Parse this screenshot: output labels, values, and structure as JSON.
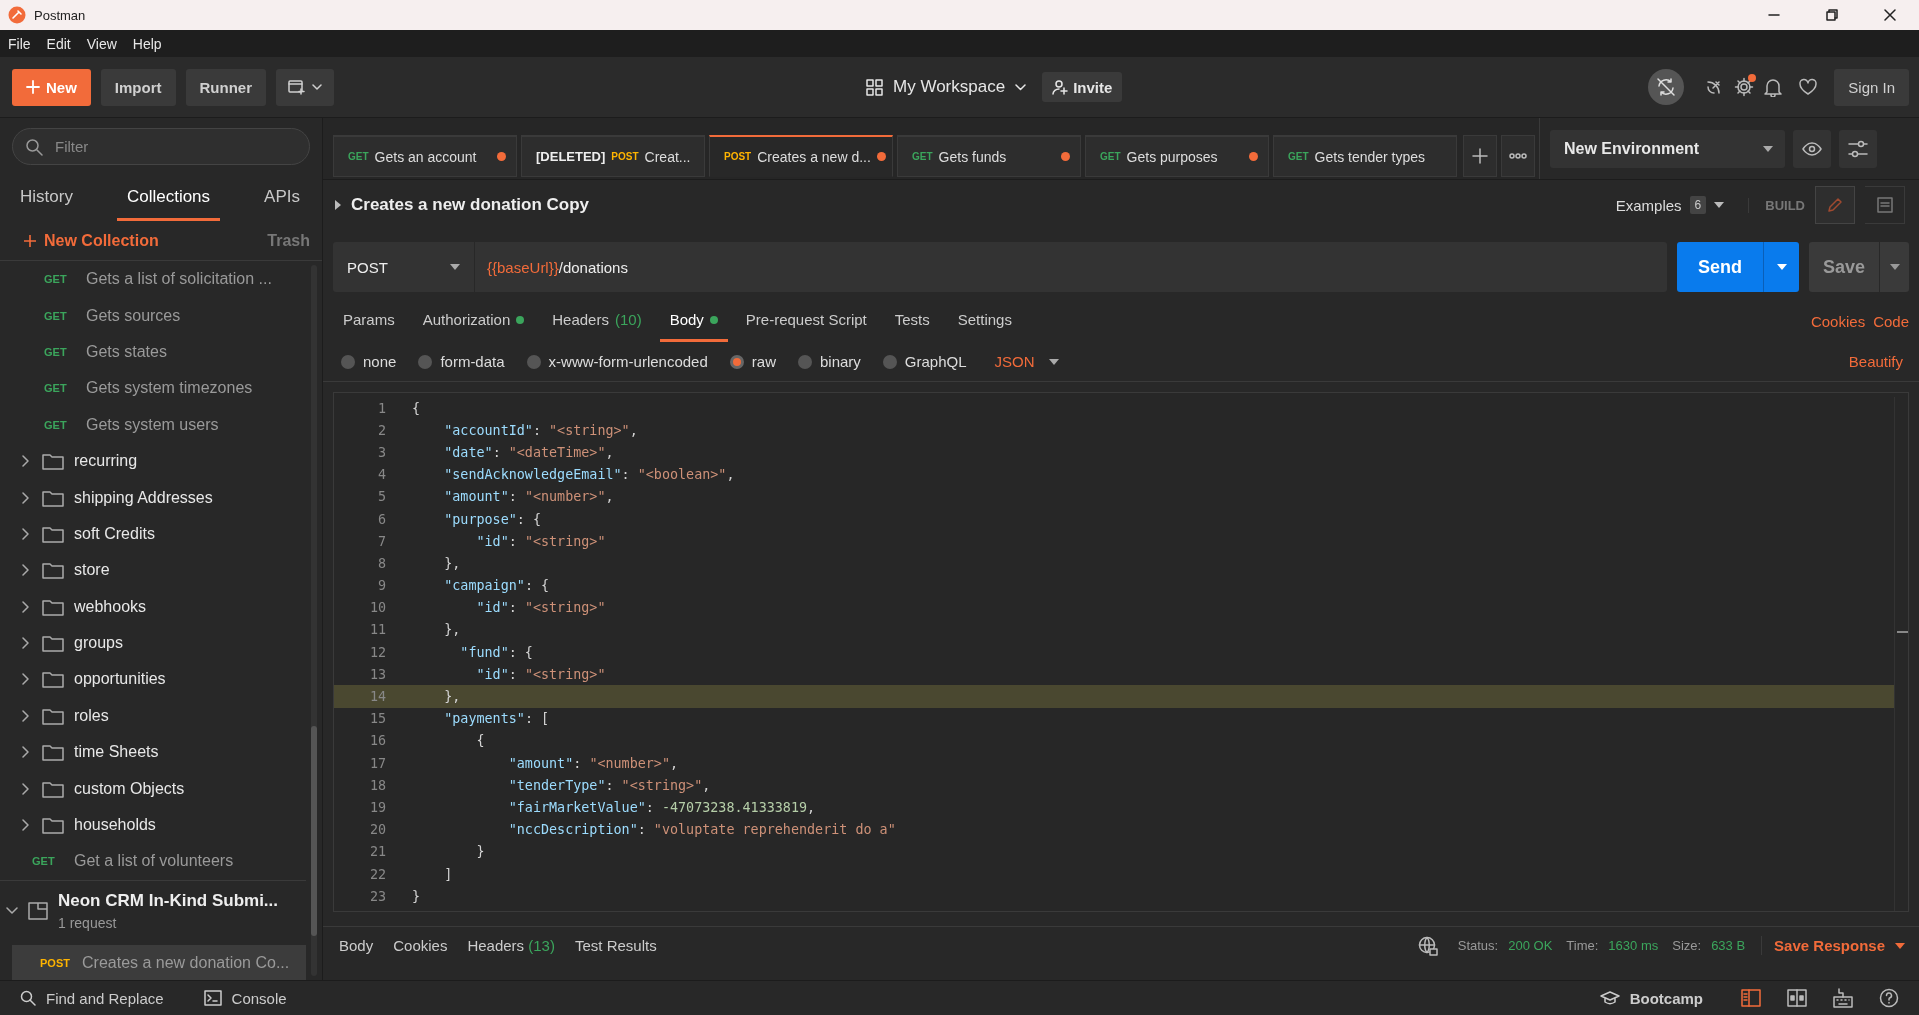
{
  "window": {
    "title": "Postman"
  },
  "menu": [
    "File",
    "Edit",
    "View",
    "Help"
  ],
  "header": {
    "new_button": "New",
    "import_button": "Import",
    "runner_button": "Runner",
    "workspace": "My Workspace",
    "invite_button": "Invite",
    "settings_notification": true,
    "sign_in_button": "Sign In"
  },
  "sidebar": {
    "filter_placeholder": "Filter",
    "tabs": [
      {
        "label": "History",
        "selected": false
      },
      {
        "label": "Collections",
        "selected": true
      },
      {
        "label": "APIs",
        "selected": false
      }
    ],
    "new_collection": "New Collection",
    "trash": "Trash",
    "items": [
      {
        "kind": "request",
        "method": "GET",
        "color": "#3ba55c",
        "name": "Gets a list of solicitation ..."
      },
      {
        "kind": "request",
        "method": "GET",
        "color": "#3ba55c",
        "name": "Gets sources"
      },
      {
        "kind": "request",
        "method": "GET",
        "color": "#3ba55c",
        "name": "Gets states"
      },
      {
        "kind": "request",
        "method": "GET",
        "color": "#3ba55c",
        "name": "Gets system timezones"
      },
      {
        "kind": "request",
        "method": "GET",
        "color": "#3ba55c",
        "name": "Gets system users"
      },
      {
        "kind": "folder",
        "name": "recurring",
        "expanded": false
      },
      {
        "kind": "folder",
        "name": "shipping Addresses",
        "expanded": false
      },
      {
        "kind": "folder",
        "name": "soft Credits",
        "expanded": false
      },
      {
        "kind": "folder",
        "name": "store",
        "expanded": false
      },
      {
        "kind": "folder",
        "name": "webhooks",
        "expanded": false
      },
      {
        "kind": "folder",
        "name": "groups",
        "expanded": false
      },
      {
        "kind": "folder",
        "name": "opportunities",
        "expanded": false
      },
      {
        "kind": "folder",
        "name": "roles",
        "expanded": false
      },
      {
        "kind": "folder",
        "name": "time Sheets",
        "expanded": false
      },
      {
        "kind": "folder",
        "name": "custom Objects",
        "expanded": false
      },
      {
        "kind": "folder",
        "name": "households",
        "expanded": false
      },
      {
        "kind": "request",
        "method": "GET",
        "color": "#3ba55c",
        "name": "Get a list of volunteers"
      }
    ],
    "collection": {
      "name": "Neon CRM In-Kind Submi...",
      "count": "1 request",
      "expanded": true,
      "requests": [
        {
          "method": "POST",
          "color": "#ffb400",
          "name": "Creates a new donation Co...",
          "selected": true
        }
      ]
    }
  },
  "request_tabs": [
    {
      "method": "GET",
      "color": "#3ba55c",
      "label": "Gets an account",
      "unsaved": true,
      "selected": false
    },
    {
      "prefix": "[DELETED]",
      "method": "POST",
      "color": "#ffb400",
      "label": "Creat...",
      "unsaved": false,
      "selected": false
    },
    {
      "method": "POST",
      "color": "#ffb400",
      "label": "Creates a new d...",
      "unsaved": true,
      "selected": true
    },
    {
      "method": "GET",
      "color": "#3ba55c",
      "label": "Gets funds",
      "unsaved": true,
      "selected": false
    },
    {
      "method": "GET",
      "color": "#3ba55c",
      "label": "Gets purposes",
      "unsaved": true,
      "selected": false
    },
    {
      "method": "GET",
      "color": "#3ba55c",
      "label": "Gets tender types",
      "unsaved": false,
      "selected": false
    }
  ],
  "environment": {
    "value": "New Environment"
  },
  "request": {
    "title": "Creates a new donation Copy",
    "examples_label": "Examples",
    "examples_count": "6",
    "build_label": "BUILD",
    "method": "POST",
    "url_variable": "{{baseUrl}}",
    "url_path": "/donations",
    "send_button": "Send",
    "save_button": "Save",
    "tabs": [
      {
        "label": "Params",
        "selected": false,
        "dot": false
      },
      {
        "label": "Authorization",
        "selected": false,
        "dot": true
      },
      {
        "label": "Headers",
        "count": "(10)",
        "selected": false,
        "dot": false
      },
      {
        "label": "Body",
        "selected": true,
        "dot": true
      },
      {
        "label": "Pre-request Script",
        "selected": false,
        "dot": false
      },
      {
        "label": "Tests",
        "selected": false,
        "dot": false
      },
      {
        "label": "Settings",
        "selected": false,
        "dot": false
      }
    ],
    "cookies_link": "Cookies",
    "code_link": "Code",
    "body_types": [
      {
        "label": "none",
        "selected": false
      },
      {
        "label": "form-data",
        "selected": false
      },
      {
        "label": "x-www-form-urlencoded",
        "selected": false
      },
      {
        "label": "raw",
        "selected": true
      },
      {
        "label": "binary",
        "selected": false
      },
      {
        "label": "GraphQL",
        "selected": false
      }
    ],
    "format": "JSON",
    "beautify_link": "Beautify"
  },
  "editor": {
    "lines": [
      {
        "number": "1",
        "current": false,
        "tokens": [
          {
            "kind": "punct",
            "text": "{"
          }
        ]
      },
      {
        "number": "2",
        "current": false,
        "tokens": [
          {
            "kind": "key",
            "text": "    \"accountId\""
          },
          {
            "kind": "punct",
            "text": ": "
          },
          {
            "kind": "string",
            "text": "\"<string>\""
          },
          {
            "kind": "punct",
            "text": ","
          }
        ]
      },
      {
        "number": "3",
        "current": false,
        "tokens": [
          {
            "kind": "key",
            "text": "    \"date\""
          },
          {
            "kind": "punct",
            "text": ": "
          },
          {
            "kind": "string",
            "text": "\"<dateTime>\""
          },
          {
            "kind": "punct",
            "text": ","
          }
        ]
      },
      {
        "number": "4",
        "current": false,
        "tokens": [
          {
            "kind": "key",
            "text": "    \"sendAcknowledgeEmail\""
          },
          {
            "kind": "punct",
            "text": ": "
          },
          {
            "kind": "string",
            "text": "\"<boolean>\""
          },
          {
            "kind": "punct",
            "text": ","
          }
        ]
      },
      {
        "number": "5",
        "current": false,
        "tokens": [
          {
            "kind": "key",
            "text": "    \"amount\""
          },
          {
            "kind": "punct",
            "text": ": "
          },
          {
            "kind": "string",
            "text": "\"<number>\""
          },
          {
            "kind": "punct",
            "text": ","
          }
        ]
      },
      {
        "number": "6",
        "current": false,
        "tokens": [
          {
            "kind": "key",
            "text": "    \"purpose\""
          },
          {
            "kind": "punct",
            "text": ": {"
          }
        ]
      },
      {
        "number": "7",
        "current": false,
        "tokens": [
          {
            "kind": "key",
            "text": "        \"id\""
          },
          {
            "kind": "punct",
            "text": ": "
          },
          {
            "kind": "string",
            "text": "\"<string>\""
          }
        ]
      },
      {
        "number": "8",
        "current": false,
        "tokens": [
          {
            "kind": "punct",
            "text": "    },"
          }
        ]
      },
      {
        "number": "9",
        "current": false,
        "tokens": [
          {
            "kind": "key",
            "text": "    \"campaign\""
          },
          {
            "kind": "punct",
            "text": ": {"
          }
        ]
      },
      {
        "number": "10",
        "current": false,
        "tokens": [
          {
            "kind": "key",
            "text": "        \"id\""
          },
          {
            "kind": "punct",
            "text": ": "
          },
          {
            "kind": "string",
            "text": "\"<string>\""
          }
        ]
      },
      {
        "number": "11",
        "current": false,
        "tokens": [
          {
            "kind": "punct",
            "text": "    },"
          }
        ]
      },
      {
        "number": "12",
        "current": false,
        "tokens": [
          {
            "kind": "key",
            "text": "      \"fund\""
          },
          {
            "kind": "punct",
            "text": ": {"
          }
        ]
      },
      {
        "number": "13",
        "current": false,
        "tokens": [
          {
            "kind": "key",
            "text": "        \"id\""
          },
          {
            "kind": "punct",
            "text": ": "
          },
          {
            "kind": "string",
            "text": "\"<string>\""
          }
        ]
      },
      {
        "number": "14",
        "current": true,
        "tokens": [
          {
            "kind": "punct",
            "text": "    },"
          }
        ]
      },
      {
        "number": "15",
        "current": false,
        "tokens": [
          {
            "kind": "key",
            "text": "    \"payments\""
          },
          {
            "kind": "punct",
            "text": ": ["
          }
        ]
      },
      {
        "number": "16",
        "current": false,
        "tokens": [
          {
            "kind": "punct",
            "text": "        {"
          }
        ]
      },
      {
        "number": "17",
        "current": false,
        "tokens": [
          {
            "kind": "key",
            "text": "            \"amount\""
          },
          {
            "kind": "punct",
            "text": ": "
          },
          {
            "kind": "string",
            "text": "\"<number>\""
          },
          {
            "kind": "punct",
            "text": ","
          }
        ]
      },
      {
        "number": "18",
        "current": false,
        "tokens": [
          {
            "kind": "key",
            "text": "            \"tenderType\""
          },
          {
            "kind": "punct",
            "text": ": "
          },
          {
            "kind": "string",
            "text": "\"<string>\""
          },
          {
            "kind": "punct",
            "text": ","
          }
        ]
      },
      {
        "number": "19",
        "current": false,
        "tokens": [
          {
            "kind": "key",
            "text": "            \"fairMarketValue\""
          },
          {
            "kind": "punct",
            "text": ": "
          },
          {
            "kind": "number",
            "text": "-47073238.41333819"
          },
          {
            "kind": "punct",
            "text": ","
          }
        ]
      },
      {
        "number": "20",
        "current": false,
        "tokens": [
          {
            "kind": "key",
            "text": "            \"nccDescription\""
          },
          {
            "kind": "punct",
            "text": ": "
          },
          {
            "kind": "string",
            "text": "\"voluptate reprehenderit do a\""
          }
        ]
      },
      {
        "number": "21",
        "current": false,
        "tokens": [
          {
            "kind": "punct",
            "text": "        }"
          }
        ]
      },
      {
        "number": "22",
        "current": false,
        "tokens": [
          {
            "kind": "punct",
            "text": "    ]"
          }
        ]
      },
      {
        "number": "23",
        "current": false,
        "tokens": [
          {
            "kind": "punct",
            "text": "}"
          }
        ]
      }
    ]
  },
  "response": {
    "tabs": [
      {
        "label": "Body"
      },
      {
        "label": "Cookies"
      },
      {
        "label": "Headers",
        "count": "(13)"
      },
      {
        "label": "Test Results"
      }
    ],
    "status_label": "Status:",
    "status": "200 OK",
    "time_label": "Time:",
    "time": "1630 ms",
    "size_label": "Size:",
    "size": "633 B",
    "save_response": "Save Response"
  },
  "footer": {
    "find_replace": "Find and Replace",
    "console": "Console",
    "bootcamp": "Bootcamp"
  }
}
